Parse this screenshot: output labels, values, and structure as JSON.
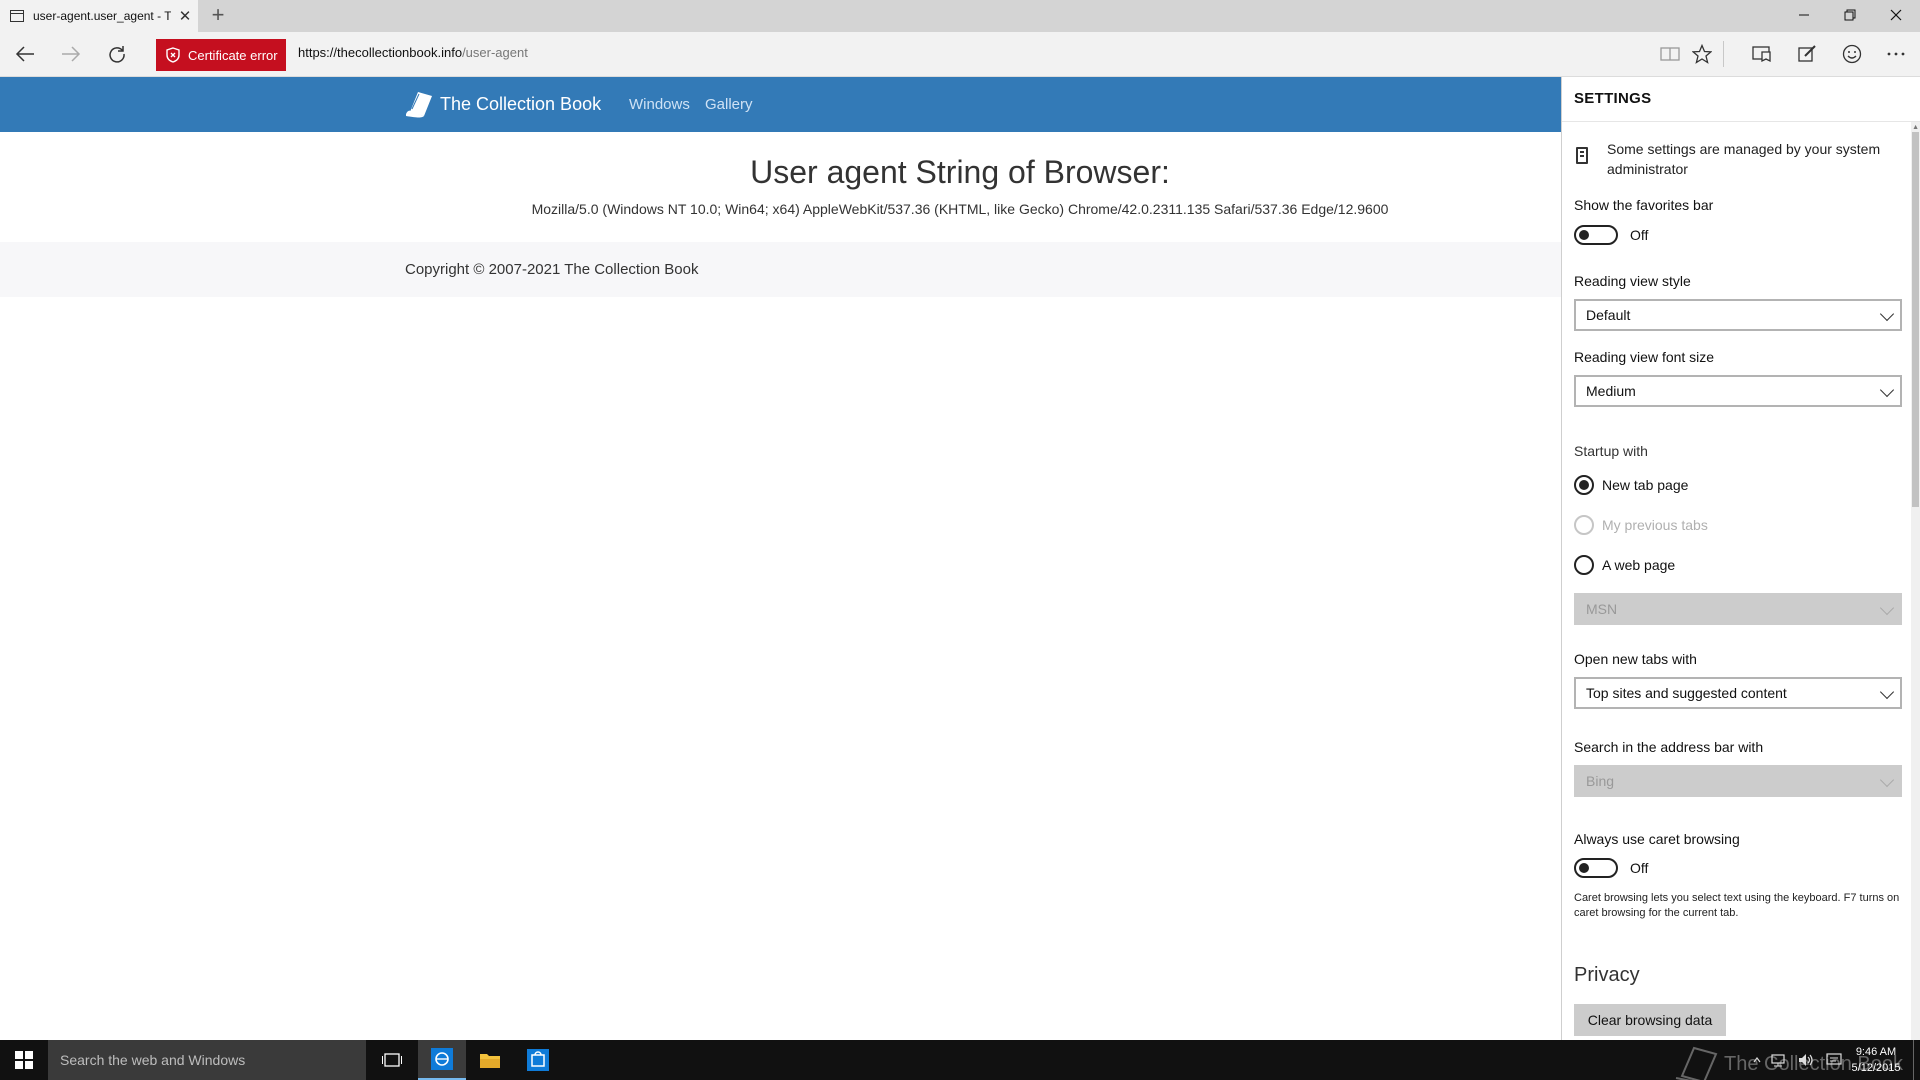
{
  "tab": {
    "title": "user-agent.user_agent - Th",
    "close": "✕",
    "new_tab": "+"
  },
  "window": {
    "minimize": "—",
    "maximize": "❐",
    "close": "✕"
  },
  "addressbar": {
    "certificate_error": "Certificate error",
    "url_host": "https://thecollectionbook.info",
    "url_path": "/user-agent"
  },
  "site": {
    "brand": "The Collection Book",
    "nav": [
      "Windows",
      "Gallery"
    ],
    "heading": "User agent String of Browser:",
    "user_agent": "Mozilla/5.0 (Windows NT 10.0; Win64; x64) AppleWebKit/537.36 (KHTML, like Gecko) Chrome/42.0.2311.135 Safari/537.36 Edge/12.9600",
    "copyright": "Copyright © 2007-2021 The Collection Book"
  },
  "settings": {
    "title": "SETTINGS",
    "managed_notice": "Some settings are managed by your system administrator",
    "favorites_bar": {
      "label": "Show the favorites bar",
      "state": "Off"
    },
    "reading_view_style": {
      "label": "Reading view style",
      "value": "Default"
    },
    "reading_view_font_size": {
      "label": "Reading view font size",
      "value": "Medium"
    },
    "startup": {
      "label": "Startup with",
      "options": [
        "New tab page",
        "My previous tabs",
        "A web page"
      ],
      "selected": "New tab page",
      "web_page_value": "MSN"
    },
    "open_new_tabs": {
      "label": "Open new tabs with",
      "value": "Top sites and suggested content"
    },
    "search_address_bar": {
      "label": "Search in the address bar with",
      "value": "Bing"
    },
    "caret_browsing": {
      "label": "Always use caret browsing",
      "state": "Off",
      "help": "Caret browsing lets you select text using the keyboard. F7 turns on caret browsing for the current tab."
    },
    "privacy": {
      "heading": "Privacy",
      "clear_button": "Clear browsing data"
    }
  },
  "taskbar": {
    "search_placeholder": "Search the web and Windows",
    "watermark": "The Collection Book",
    "time": "9:46 AM",
    "date": "5/12/2015"
  },
  "colors": {
    "site_header": "#337ab7",
    "certificate_error": "#c50f1f",
    "taskbar": "#111111"
  }
}
